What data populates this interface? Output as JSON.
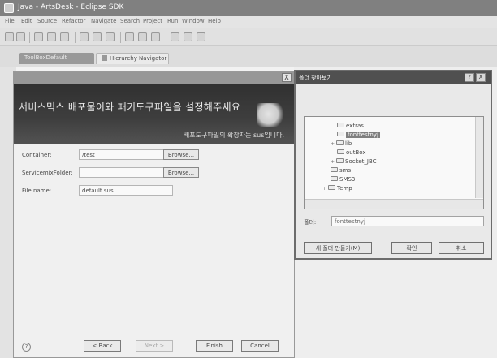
{
  "window": {
    "title": "Java - ArtsDesk - Eclipse SDK"
  },
  "menu": [
    "File",
    "Edit",
    "Source",
    "Refactor",
    "Navigate",
    "Search",
    "Project",
    "Run",
    "Window",
    "Help"
  ],
  "tabs": {
    "first": "ToolBoxDefault",
    "second": "Hierarchy Navigator"
  },
  "wizard": {
    "banner_heading": "서비스믹스 배포물이와 패키도구파일을 설정해주세요",
    "banner_sub": "배포도구파일의 확장자는 sus입니다.",
    "container_label": "Container:",
    "container_value": "/test",
    "browse1": "Browse...",
    "servicemix_label": "ServicemixFolder:",
    "servicemix_value": "",
    "browse2": "Browse...",
    "filename_label": "File name:",
    "filename_value": "default.sus",
    "help": "?",
    "back": "< Back",
    "next": "Next >",
    "finish": "Finish",
    "cancel": "Cancel",
    "close": "X"
  },
  "browse_dialog": {
    "title": "폴더 찾아보기",
    "help": "?",
    "close": "X",
    "tree": [
      "extras",
      "fonttestnyj",
      "lib",
      "outBox",
      "Socket_JBC",
      "sms",
      "SMS3",
      "Temp"
    ],
    "selected": "fonttestnyj",
    "folder_label": "폴더:",
    "folder_value": "fonttestnyj",
    "new_folder_button": "새 폴더 만들기(M)",
    "ok_button": "확인",
    "cancel_button": "취소"
  }
}
